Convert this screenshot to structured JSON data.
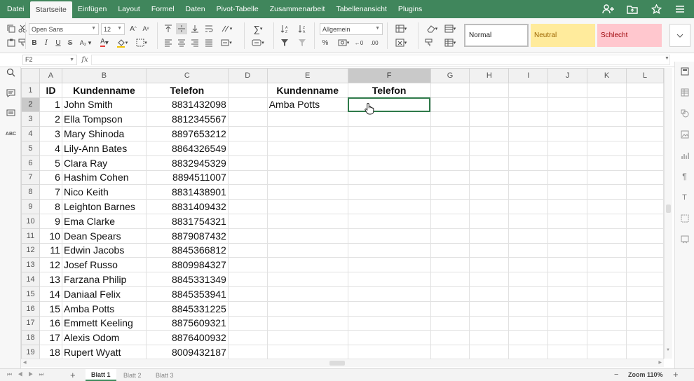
{
  "menu": {
    "tabs": [
      "Datei",
      "Startseite",
      "Einfügen",
      "Layout",
      "Formel",
      "Daten",
      "Pivot-Tabelle",
      "Zusammenarbeit",
      "Tabellenansicht",
      "Plugins"
    ],
    "active_index": 1,
    "accent_color": "#40865c"
  },
  "toolbar": {
    "font_name": "Open Sans",
    "font_size": "12",
    "number_format": "Allgemein",
    "styles": [
      {
        "label": "Normal",
        "bg": "#ffffff",
        "fg": "#222222"
      },
      {
        "label": "Neutral",
        "bg": "#ffeb9c",
        "fg": "#9c6500"
      },
      {
        "label": "Schlecht",
        "bg": "#ffc7ce",
        "fg": "#9c0006"
      }
    ]
  },
  "formula_bar": {
    "cell_ref": "F2",
    "fx_label": "fx",
    "value": ""
  },
  "grid": {
    "columns": [
      "A",
      "B",
      "C",
      "D",
      "E",
      "F",
      "G",
      "H",
      "I",
      "J",
      "K",
      "L"
    ],
    "selected_column": "F",
    "selected_row": 2,
    "header_row": [
      "ID",
      "Kundenname",
      "Telefon",
      "",
      "Kundenname",
      "Telefon"
    ],
    "rows": [
      {
        "id": "1",
        "name": "John Smith",
        "phone": "8831432098"
      },
      {
        "id": "2",
        "name": "Ella Tompson",
        "phone": "8812345567"
      },
      {
        "id": "3",
        "name": "Mary Shinoda",
        "phone": "8897653212"
      },
      {
        "id": "4",
        "name": "Lily-Ann Bates",
        "phone": "8864326549"
      },
      {
        "id": "5",
        "name": "Clara Ray",
        "phone": "8832945329"
      },
      {
        "id": "6",
        "name": "Hashim Cohen",
        "phone": "8894511007"
      },
      {
        "id": "7",
        "name": "Nico Keith",
        "phone": "8831438901"
      },
      {
        "id": "8",
        "name": "Leighton Barnes",
        "phone": "8831409432"
      },
      {
        "id": "9",
        "name": "Ema Clarke",
        "phone": "8831754321"
      },
      {
        "id": "10",
        "name": "Dean Spears",
        "phone": "8879087432"
      },
      {
        "id": "11",
        "name": "Edwin Jacobs",
        "phone": "8845366812"
      },
      {
        "id": "12",
        "name": "Josef Russo",
        "phone": "8809984327"
      },
      {
        "id": "13",
        "name": "Farzana Philip",
        "phone": "8845331349"
      },
      {
        "id": "14",
        "name": "Daniaal Felix",
        "phone": "8845353941"
      },
      {
        "id": "15",
        "name": "Amba Potts",
        "phone": "8845331225"
      },
      {
        "id": "16",
        "name": "Emmett Keeling",
        "phone": "8875609321"
      },
      {
        "id": "17",
        "name": "Alexis Odom",
        "phone": "8876400932"
      },
      {
        "id": "18",
        "name": "Rupert Wyatt",
        "phone": "8009432187"
      }
    ],
    "lookup_name": "Amba Potts",
    "lookup_phone": ""
  },
  "sheets": {
    "tabs": [
      "Blatt 1",
      "Blatt 2",
      "Blatt 3"
    ],
    "active_index": 0,
    "zoom_label": "Zoom 110%"
  }
}
